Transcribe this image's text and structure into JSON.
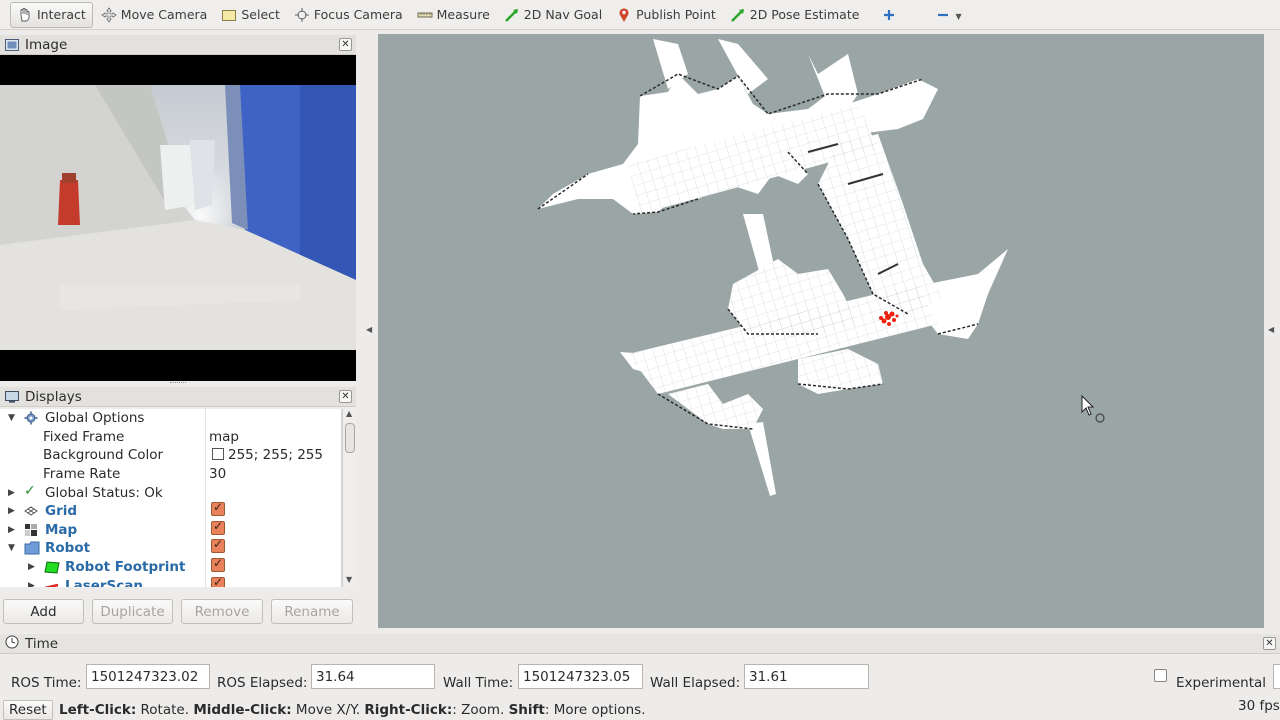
{
  "toolbar": {
    "tools": [
      {
        "label": "Interact",
        "icon": "hand-icon",
        "active": true
      },
      {
        "label": "Move Camera",
        "icon": "move-camera-icon"
      },
      {
        "label": "Select",
        "icon": "select-icon"
      },
      {
        "label": "Focus Camera",
        "icon": "focus-camera-icon"
      },
      {
        "label": "Measure",
        "icon": "ruler-icon"
      },
      {
        "label": "2D Nav Goal",
        "icon": "green-arrow-icon"
      },
      {
        "label": "Publish Point",
        "icon": "map-pin-icon"
      },
      {
        "label": "2D Pose Estimate",
        "icon": "green-arrow-icon"
      }
    ]
  },
  "image_panel": {
    "title": "Image"
  },
  "displays_panel": {
    "title": "Displays",
    "rows": [
      {
        "label": "Global Options",
        "value": ""
      },
      {
        "label": "Fixed Frame",
        "value": "map"
      },
      {
        "label": "Background Color",
        "value": "255; 255; 255"
      },
      {
        "label": "Frame Rate",
        "value": "30"
      },
      {
        "label": "Global Status: Ok",
        "value": ""
      },
      {
        "label": "Grid",
        "checked": true
      },
      {
        "label": "Map",
        "checked": true
      },
      {
        "label": "Robot",
        "checked": true
      },
      {
        "label": "Robot Footprint",
        "checked": true
      },
      {
        "label": "LaserScan",
        "checked": true
      }
    ],
    "buttons": {
      "add": "Add",
      "duplicate": "Duplicate",
      "remove": "Remove",
      "rename": "Rename"
    }
  },
  "time_panel": {
    "title": "Time",
    "ros_time_label": "ROS Time:",
    "ros_time": "1501247323.02",
    "ros_elapsed_label": "ROS Elapsed:",
    "ros_elapsed": "31.64",
    "wall_time_label": "Wall Time:",
    "wall_time": "1501247323.05",
    "wall_elapsed_label": "Wall Elapsed:",
    "wall_elapsed": "31.61",
    "experimental_label": "Experimental"
  },
  "status_bar": {
    "reset": "Reset",
    "hint_left_key": "Left-Click:",
    "hint_left": " Rotate. ",
    "hint_middle_key": "Middle-Click:",
    "hint_middle": " Move X/Y. ",
    "hint_right_key": "Right-Click:",
    "hint_right": ": Zoom. ",
    "hint_shift_key": "Shift",
    "hint_shift": ": More options.",
    "fps": "30 fps"
  },
  "colors": {
    "render_background": "#9aa6a6",
    "checkbox_orange": "#e9825a",
    "tree_blue": "#2a6aa6",
    "laser_red": "#ee2211"
  }
}
